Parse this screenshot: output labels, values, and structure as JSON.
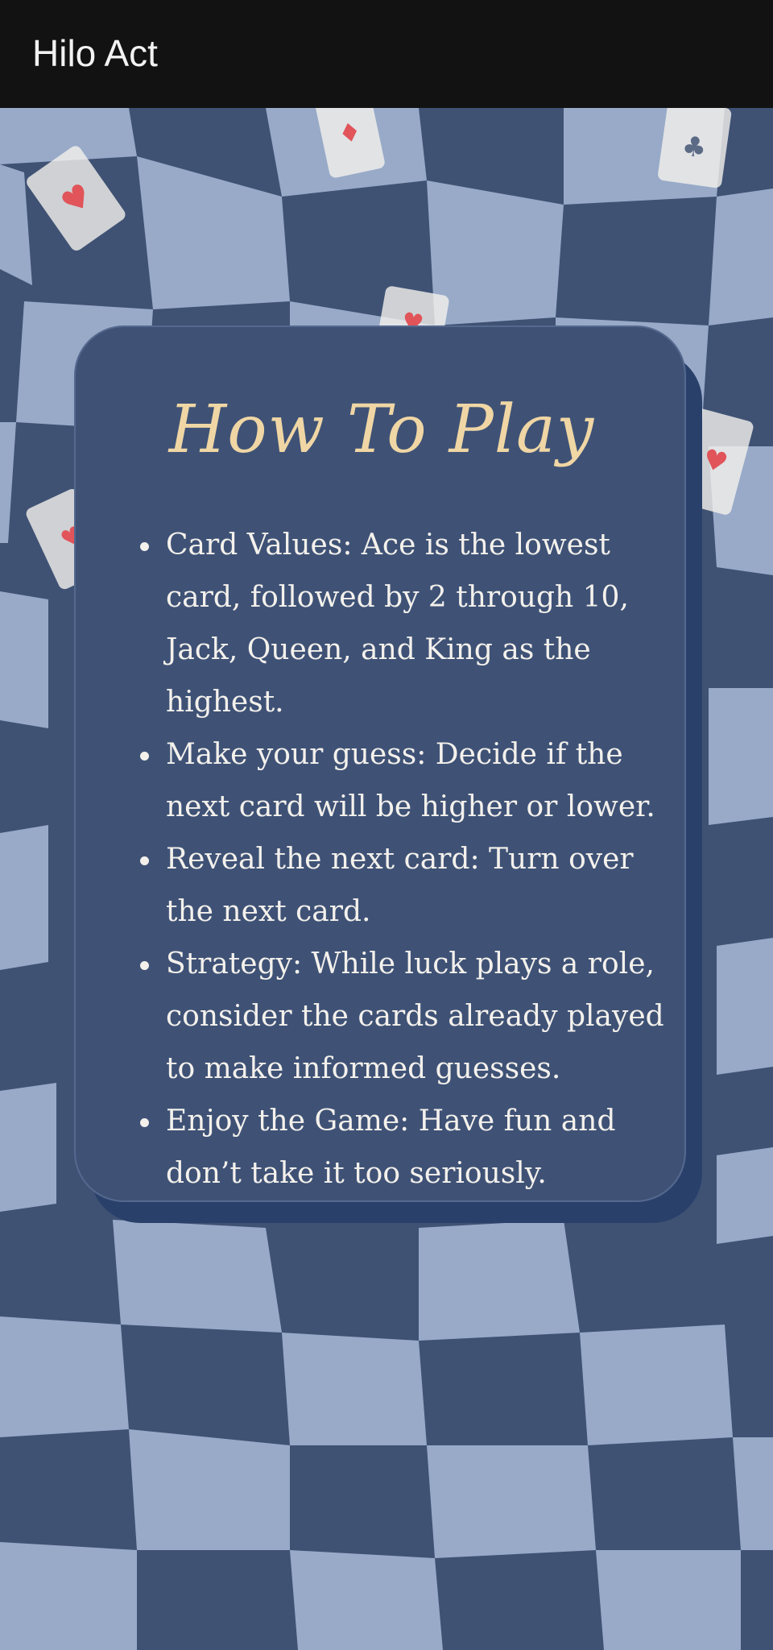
{
  "app_bar": {
    "title": "Hilo Act"
  },
  "how_to_play": {
    "title": "How To Play",
    "rules": [
      "Card Values: Ace is the lowest card, followed by 2 through 10, Jack, Queen, and King as the highest.",
      "Make your guess: Decide if the next card will be higher or lower.",
      "Reveal the next card: Turn over the next card.",
      "Strategy: While luck plays a role, consider the cards already played to make informed guesses.",
      "Enjoy the Game: Have fun and don’t take it too seriously."
    ]
  },
  "background": {
    "pattern": "wavy-checkerboard",
    "decorations": [
      "hearts-card-icon",
      "hearts-card-icon",
      "hearts-card-icon",
      "hearts-card-icon",
      "clubs-card-icon",
      "hearts-card-icon"
    ]
  },
  "colors": {
    "dark_square": "#3f5274",
    "light_square": "#98aac8",
    "card_background": "#3f5276",
    "title_gold": "#efd6a4",
    "suit_red": "#e0545a"
  }
}
